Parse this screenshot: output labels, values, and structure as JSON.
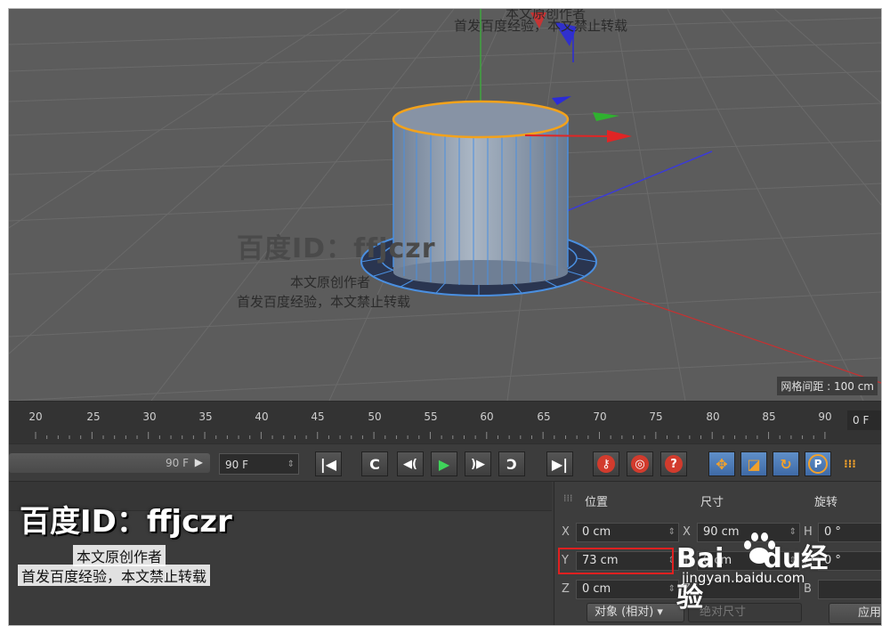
{
  "viewport": {
    "grid_spacing_label": "网格间距 : 100 cm",
    "watermark_id": "百度ID：ffjczr",
    "watermark_line1": "本文原创作者",
    "watermark_line2": "首发百度经验，本文禁止转载",
    "top_watermark_line1": "本文原创作者",
    "top_watermark_line2": "首发百度经验，本文禁止转载"
  },
  "timeline": {
    "ticks": [
      "20",
      "25",
      "30",
      "35",
      "40",
      "45",
      "50",
      "55",
      "60",
      "65",
      "70",
      "75",
      "80",
      "85",
      "90"
    ],
    "current_frame": "0 F"
  },
  "transport": {
    "slider_value": "90 F",
    "end_frame": "90 F"
  },
  "coords": {
    "headers": {
      "position": "位置",
      "size": "尺寸",
      "rotation": "旋转"
    },
    "rows": [
      {
        "pos_axis": "X",
        "pos_value": "0 cm",
        "size_axis": "X",
        "size_value": "90 cm",
        "rot_axis": "H",
        "rot_value": "0 °"
      },
      {
        "pos_axis": "Y",
        "pos_value": "73 cm",
        "size_axis": "Y",
        "size_value": "0 cm",
        "rot_axis": "P",
        "rot_value": "0 °"
      },
      {
        "pos_axis": "Z",
        "pos_value": "0 cm",
        "size_axis": "Z",
        "size_value": "",
        "rot_axis": "B",
        "rot_value": ""
      }
    ],
    "mode_dropdown": "对象 (相对)",
    "size_mode": "绝对尺寸",
    "apply_label": "应用"
  },
  "left_watermark": {
    "id": "百度ID：ffjczr",
    "line1": "本文原创作者",
    "line2": "首发百度经验，本文禁止转载"
  },
  "baidu": {
    "logo_left": "Bai",
    "logo_right": "du",
    "logo_cn": "经验",
    "site": "jingyan.baidu.com"
  }
}
